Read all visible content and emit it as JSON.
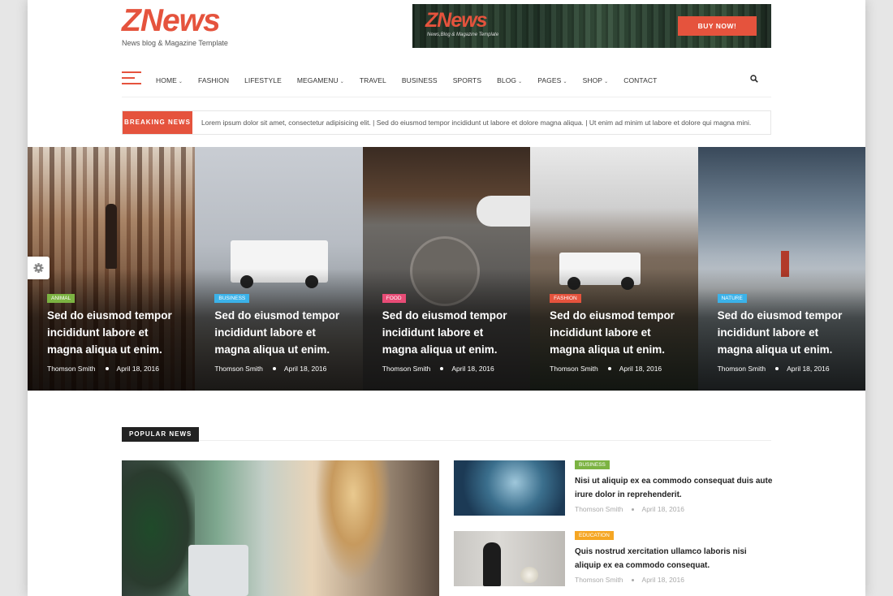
{
  "header": {
    "logo": "ZNews",
    "tagline": "News blog & Magazine Template"
  },
  "banner": {
    "logo": "ZNews",
    "tagline": "News,Blog & Magazine Template",
    "button": "BUY NOW!"
  },
  "nav": {
    "items": [
      {
        "label": "HOME",
        "dropdown": true
      },
      {
        "label": "FASHION",
        "dropdown": false
      },
      {
        "label": "LIFESTYLE",
        "dropdown": false
      },
      {
        "label": "MEGAMENU",
        "dropdown": true
      },
      {
        "label": "TRAVEL",
        "dropdown": false
      },
      {
        "label": "BUSINESS",
        "dropdown": false
      },
      {
        "label": "SPORTS",
        "dropdown": false
      },
      {
        "label": "BLOG",
        "dropdown": true
      },
      {
        "label": "PAGES",
        "dropdown": true
      },
      {
        "label": "SHOP",
        "dropdown": true
      },
      {
        "label": "CONTACT",
        "dropdown": false
      }
    ],
    "dropdown_caret": "⌄"
  },
  "breaking": {
    "label": "BREAKING NEWS",
    "text": "Lorem ipsum dolor sit amet, consectetur adipisicing elit. | Sed do eiusmod tempor incididunt ut labore et dolore magna aliqua. | Ut enim ad minim ut labore et dolore qui magna mini."
  },
  "slider": [
    {
      "category": "ANIMAL",
      "category_color": "#7cb342",
      "title": "Sed do eiusmod tempor incididunt labore et magna aliqua ut enim.",
      "author": "Thomson Smith",
      "date": "April 18, 2016"
    },
    {
      "category": "BUSINESS",
      "category_color": "#3bb2e9",
      "title": "Sed do eiusmod tempor incididunt labore et magna aliqua ut enim.",
      "author": "Thomson Smith",
      "date": "April 18, 2016"
    },
    {
      "category": "FOOD",
      "category_color": "#e84c76",
      "title": "Sed do eiusmod tempor incididunt labore et magna aliqua ut enim.",
      "author": "Thomson Smith",
      "date": "April 18, 2016"
    },
    {
      "category": "FASHION",
      "category_color": "#e5533d",
      "title": "Sed do eiusmod tempor incididunt labore et magna aliqua ut enim.",
      "author": "Thomson Smith",
      "date": "April 18, 2016"
    },
    {
      "category": "NATURE",
      "category_color": "#3bb2e9",
      "title": "Sed do eiusmod tempor incididunt labore et magna aliqua ut enim.",
      "author": "Thomson Smith",
      "date": "April 18, 2016"
    }
  ],
  "popular": {
    "heading": "POPULAR NEWS",
    "items": [
      {
        "category": "BUSINESS",
        "category_color": "#7cb342",
        "title": "Nisi ut aliquip ex ea commodo consequat duis aute irure dolor in reprehenderit.",
        "author": "Thomson Smith",
        "date": "April 18, 2016"
      },
      {
        "category": "EDUCATION",
        "category_color": "#f5a623",
        "title": "Quis nostrud xercitation ullamco laboris nisi aliquip ex ea commodo consequat.",
        "author": "Thomson Smith",
        "date": "April 18, 2016"
      }
    ]
  },
  "colors": {
    "accent": "#e5533d",
    "dark": "#222222"
  }
}
